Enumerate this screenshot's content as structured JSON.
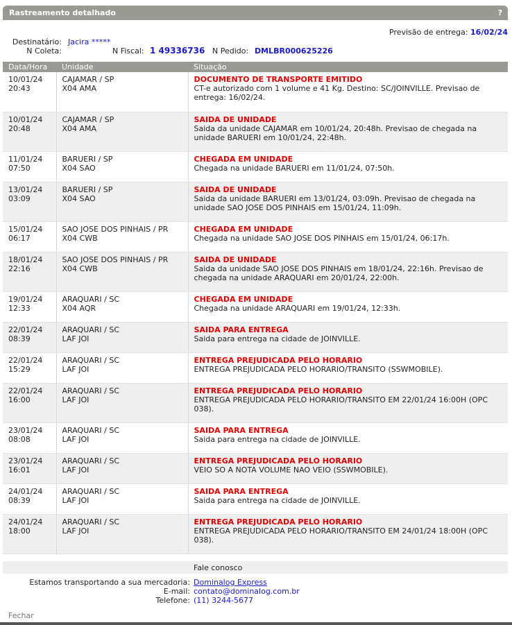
{
  "header": {
    "title": "Rastreamento detalhado",
    "help": "?"
  },
  "info": {
    "previsao_label": "Previsão de entrega:",
    "previsao_value": "16/02/24",
    "destinatario_label": "Destinatário:",
    "destinatario_value": "Jacira *****",
    "coleta_label": "N Coleta:",
    "fiscal_label": "N Fiscal:",
    "fiscal_value": "1 49336736",
    "pedido_label": "N Pedido:",
    "pedido_value": "DMLBR000625226"
  },
  "columns": [
    "Data/Hora",
    "Unidade",
    "Situação"
  ],
  "rows": [
    {
      "date": "10/01/24",
      "time": "20:43",
      "unit": "CAJAMAR / SP",
      "code": "X04 AMA",
      "status": "DOCUMENTO DE TRANSPORTE EMITIDO",
      "desc": "CT-e autorizado com 1 volume e 41 Kg. Destino: SC/JOINVILLE. Previsao de entrega: 16/02/24."
    },
    {
      "date": "10/01/24",
      "time": "20:48",
      "unit": "CAJAMAR / SP",
      "code": "X04 AMA",
      "status": "SAIDA DE UNIDADE",
      "desc": "Saida da unidade CAJAMAR em 10/01/24, 20:48h. Previsao de chegada na unidade BARUERI em 10/01/24, 22:48h."
    },
    {
      "date": "11/01/24",
      "time": "07:50",
      "unit": "BARUERI / SP",
      "code": "X04 SAO",
      "status": "CHEGADA EM UNIDADE",
      "desc": "Chegada na unidade BARUERI em 11/01/24, 07:50h."
    },
    {
      "date": "13/01/24",
      "time": "03:09",
      "unit": "BARUERI / SP",
      "code": "X04 SAO",
      "status": "SAIDA DE UNIDADE",
      "desc": "Saida da unidade BARUERI em 13/01/24, 03:09h. Previsao de chegada na unidade SAO JOSE DOS PINHAIS em 15/01/24, 11:09h."
    },
    {
      "date": "15/01/24",
      "time": "06:17",
      "unit": "SAO JOSE DOS PINHAIS / PR",
      "code": "X04 CWB",
      "status": "CHEGADA EM UNIDADE",
      "desc": "Chegada na unidade SAO JOSE DOS PINHAIS em 15/01/24, 06:17h."
    },
    {
      "date": "18/01/24",
      "time": "22:16",
      "unit": "SAO JOSE DOS PINHAIS / PR",
      "code": "X04 CWB",
      "status": "SAIDA DE UNIDADE",
      "desc": "Saida da unidade SAO JOSE DOS PINHAIS em 18/01/24, 22:16h. Previsao de chegada na unidade ARAQUARI em 20/01/24, 22:00h."
    },
    {
      "date": "19/01/24",
      "time": "12:33",
      "unit": "ARAQUARI / SC",
      "code": "X04 AQR",
      "status": "CHEGADA EM UNIDADE",
      "desc": "Chegada na unidade ARAQUARI em 19/01/24, 12:33h."
    },
    {
      "date": "22/01/24",
      "time": "08:39",
      "unit": "ARAQUARI / SC",
      "code": "LAF JOI",
      "status": "SAIDA PARA ENTREGA",
      "desc": "Saida para entrega na cidade de JOINVILLE."
    },
    {
      "date": "22/01/24",
      "time": "15:29",
      "unit": "ARAQUARI / SC",
      "code": "LAF JOI",
      "status": "ENTREGA PREJUDICADA PELO HORARIO",
      "desc": "ENTREGA PREJUDICADA PELO HORARIO/TRANSITO (SSWMOBILE)."
    },
    {
      "date": "22/01/24",
      "time": "16:00",
      "unit": "ARAQUARI / SC",
      "code": "LAF JOI",
      "status": "ENTREGA PREJUDICADA PELO HORARIO",
      "desc": "ENTREGA PREJUDICADA PELO HORARIO/TRANSITO EM 22/01/24 16:00H (OPC 038)."
    },
    {
      "date": "23/01/24",
      "time": "08:08",
      "unit": "ARAQUARI / SC",
      "code": "LAF JOI",
      "status": "SAIDA PARA ENTREGA",
      "desc": "Saida para entrega na cidade de JOINVILLE."
    },
    {
      "date": "23/01/24",
      "time": "16:01",
      "unit": "ARAQUARI / SC",
      "code": "LAF JOI",
      "status": "ENTREGA PREJUDICADA PELO HORARIO",
      "desc": "VEIO SO A NOTA VOLUME NAO VEIO (SSWMOBILE)."
    },
    {
      "date": "24/01/24",
      "time": "08:39",
      "unit": "ARAQUARI / SC",
      "code": "LAF JOI",
      "status": "SAIDA PARA ENTREGA",
      "desc": "Saida para entrega na cidade de JOINVILLE."
    },
    {
      "date": "24/01/24",
      "time": "18:00",
      "unit": "ARAQUARI / SC",
      "code": "LAF JOI",
      "status": "ENTREGA PREJUDICADA PELO HORARIO",
      "desc": "ENTREGA PREJUDICADA PELO HORARIO/TRANSITO EM 24/01/24 18:00H (OPC 038)."
    }
  ],
  "footer": {
    "fale": "Fale conosco",
    "transport_label": "Estamos transportando a sua mercadoria:",
    "transport_value": "Dominalog Express",
    "email_label": "E-mail:",
    "email_value": "contato@dominalog.com.br",
    "phone_label": "Telefone:",
    "phone_value": "(11) 3244-5677",
    "close": "Fechar"
  },
  "colors": {
    "header_bg": "#9a9a94",
    "status_red": "#e00000",
    "link_blue": "#1a1ac8",
    "row_alt": "#efefef"
  }
}
